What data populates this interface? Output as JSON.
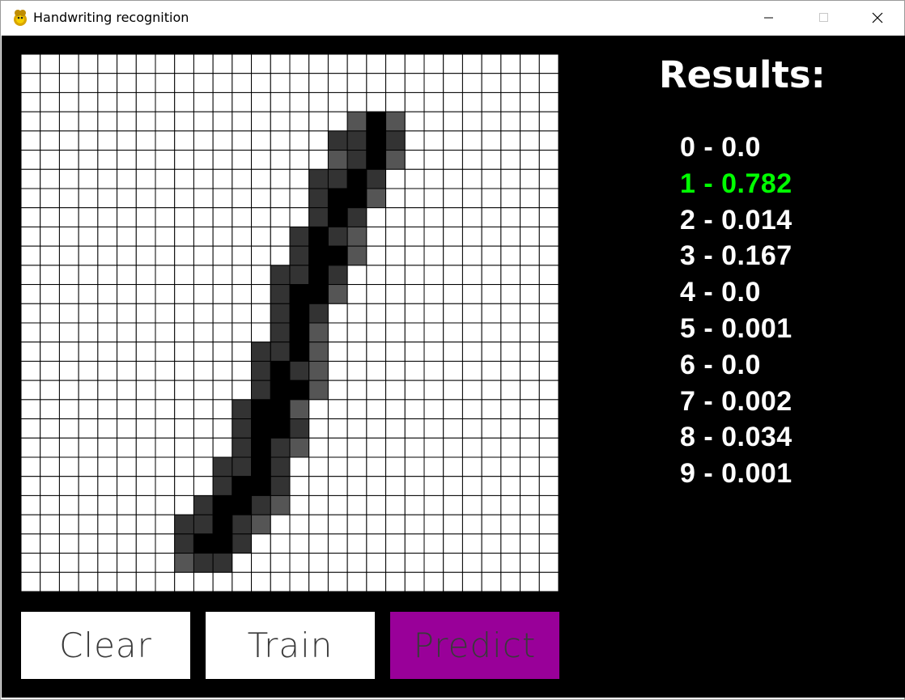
{
  "window": {
    "title": "Handwriting recognition",
    "icon": "python-icon"
  },
  "canvas": {
    "grid_size": 28,
    "colors": {
      "empty": "#ffffff",
      "full": "#000000",
      "dark": "#333333",
      "mid": "#555555",
      "line": "#000000"
    },
    "dark_cells": [
      [
        3,
        18
      ],
      [
        4,
        17
      ],
      [
        5,
        16
      ],
      [
        6,
        15
      ],
      [
        7,
        15
      ],
      [
        8,
        15
      ],
      [
        9,
        14
      ],
      [
        10,
        14
      ],
      [
        11,
        14
      ],
      [
        12,
        13
      ],
      [
        13,
        13
      ],
      [
        14,
        13
      ],
      [
        15,
        12
      ],
      [
        16,
        12
      ],
      [
        17,
        12
      ],
      [
        18,
        11
      ],
      [
        19,
        11
      ],
      [
        20,
        11
      ],
      [
        21,
        10
      ],
      [
        22,
        10
      ],
      [
        23,
        10
      ],
      [
        24,
        9
      ],
      [
        25,
        9
      ],
      [
        26,
        9
      ],
      [
        6,
        17
      ],
      [
        7,
        16
      ],
      [
        8,
        18
      ],
      [
        9,
        17
      ],
      [
        10,
        16
      ],
      [
        11,
        16
      ],
      [
        12,
        15
      ],
      [
        13,
        15
      ],
      [
        14,
        15
      ],
      [
        15,
        14
      ],
      [
        16,
        14
      ],
      [
        17,
        14
      ],
      [
        18,
        13
      ],
      [
        19,
        13
      ],
      [
        20,
        13
      ],
      [
        21,
        12
      ],
      [
        22,
        12
      ],
      [
        23,
        12
      ],
      [
        24,
        11
      ],
      [
        25,
        11
      ],
      [
        26,
        11
      ],
      [
        3,
        20
      ],
      [
        4,
        19
      ],
      [
        5,
        19
      ],
      [
        6,
        18
      ],
      [
        7,
        18
      ],
      [
        8,
        17
      ],
      [
        9,
        17
      ],
      [
        10,
        16
      ]
    ],
    "full_cells": [
      [
        3,
        19
      ],
      [
        4,
        18
      ],
      [
        5,
        18
      ],
      [
        6,
        16
      ],
      [
        7,
        16
      ],
      [
        8,
        16
      ],
      [
        9,
        15
      ],
      [
        10,
        15
      ],
      [
        11,
        15
      ],
      [
        12,
        14
      ],
      [
        13,
        14
      ],
      [
        14,
        14
      ],
      [
        15,
        13
      ],
      [
        16,
        13
      ],
      [
        17,
        13
      ],
      [
        18,
        12
      ],
      [
        19,
        12
      ],
      [
        20,
        12
      ],
      [
        21,
        11
      ],
      [
        22,
        11
      ],
      [
        23,
        11
      ],
      [
        24,
        10
      ],
      [
        25,
        10
      ],
      [
        26,
        10
      ],
      [
        7,
        17
      ],
      [
        8,
        17
      ],
      [
        25,
        9
      ],
      [
        22,
        10
      ],
      [
        19,
        11
      ],
      [
        16,
        12
      ]
    ],
    "mid_cells": [
      [
        3,
        17
      ],
      [
        4,
        16
      ],
      [
        5,
        15
      ],
      [
        6,
        14
      ],
      [
        9,
        13
      ],
      [
        12,
        12
      ],
      [
        15,
        11
      ],
      [
        18,
        10
      ],
      [
        21,
        9
      ],
      [
        24,
        8
      ],
      [
        26,
        8
      ],
      [
        27,
        8
      ],
      [
        27,
        9
      ],
      [
        4,
        20
      ],
      [
        8,
        19
      ],
      [
        9,
        19
      ],
      [
        11,
        17
      ],
      [
        12,
        17
      ],
      [
        14,
        16
      ],
      [
        15,
        16
      ],
      [
        17,
        15
      ],
      [
        18,
        15
      ],
      [
        20,
        14
      ],
      [
        21,
        14
      ],
      [
        23,
        13
      ],
      [
        24,
        13
      ],
      [
        26,
        12
      ],
      [
        27,
        12
      ]
    ]
  },
  "buttons": {
    "clear": "Clear",
    "train": "Train",
    "predict": "Predict",
    "colors": {
      "clear": "#ffffff",
      "train": "#ffffff",
      "predict": "#990099"
    }
  },
  "results": {
    "title": "Results:",
    "items": [
      {
        "text": "0 - 0.0",
        "color": "#ffffff"
      },
      {
        "text": "1 - 0.782",
        "color": "#00ff00"
      },
      {
        "text": "2 - 0.014",
        "color": "#ffffff"
      },
      {
        "text": "3 - 0.167",
        "color": "#ffffff"
      },
      {
        "text": "4 - 0.0",
        "color": "#ffffff"
      },
      {
        "text": "5 - 0.001",
        "color": "#ffffff"
      },
      {
        "text": "6 - 0.0",
        "color": "#ffffff"
      },
      {
        "text": "7 - 0.002",
        "color": "#ffffff"
      },
      {
        "text": "8 - 0.034",
        "color": "#ffffff"
      },
      {
        "text": "9 - 0.001",
        "color": "#ffffff"
      }
    ]
  }
}
